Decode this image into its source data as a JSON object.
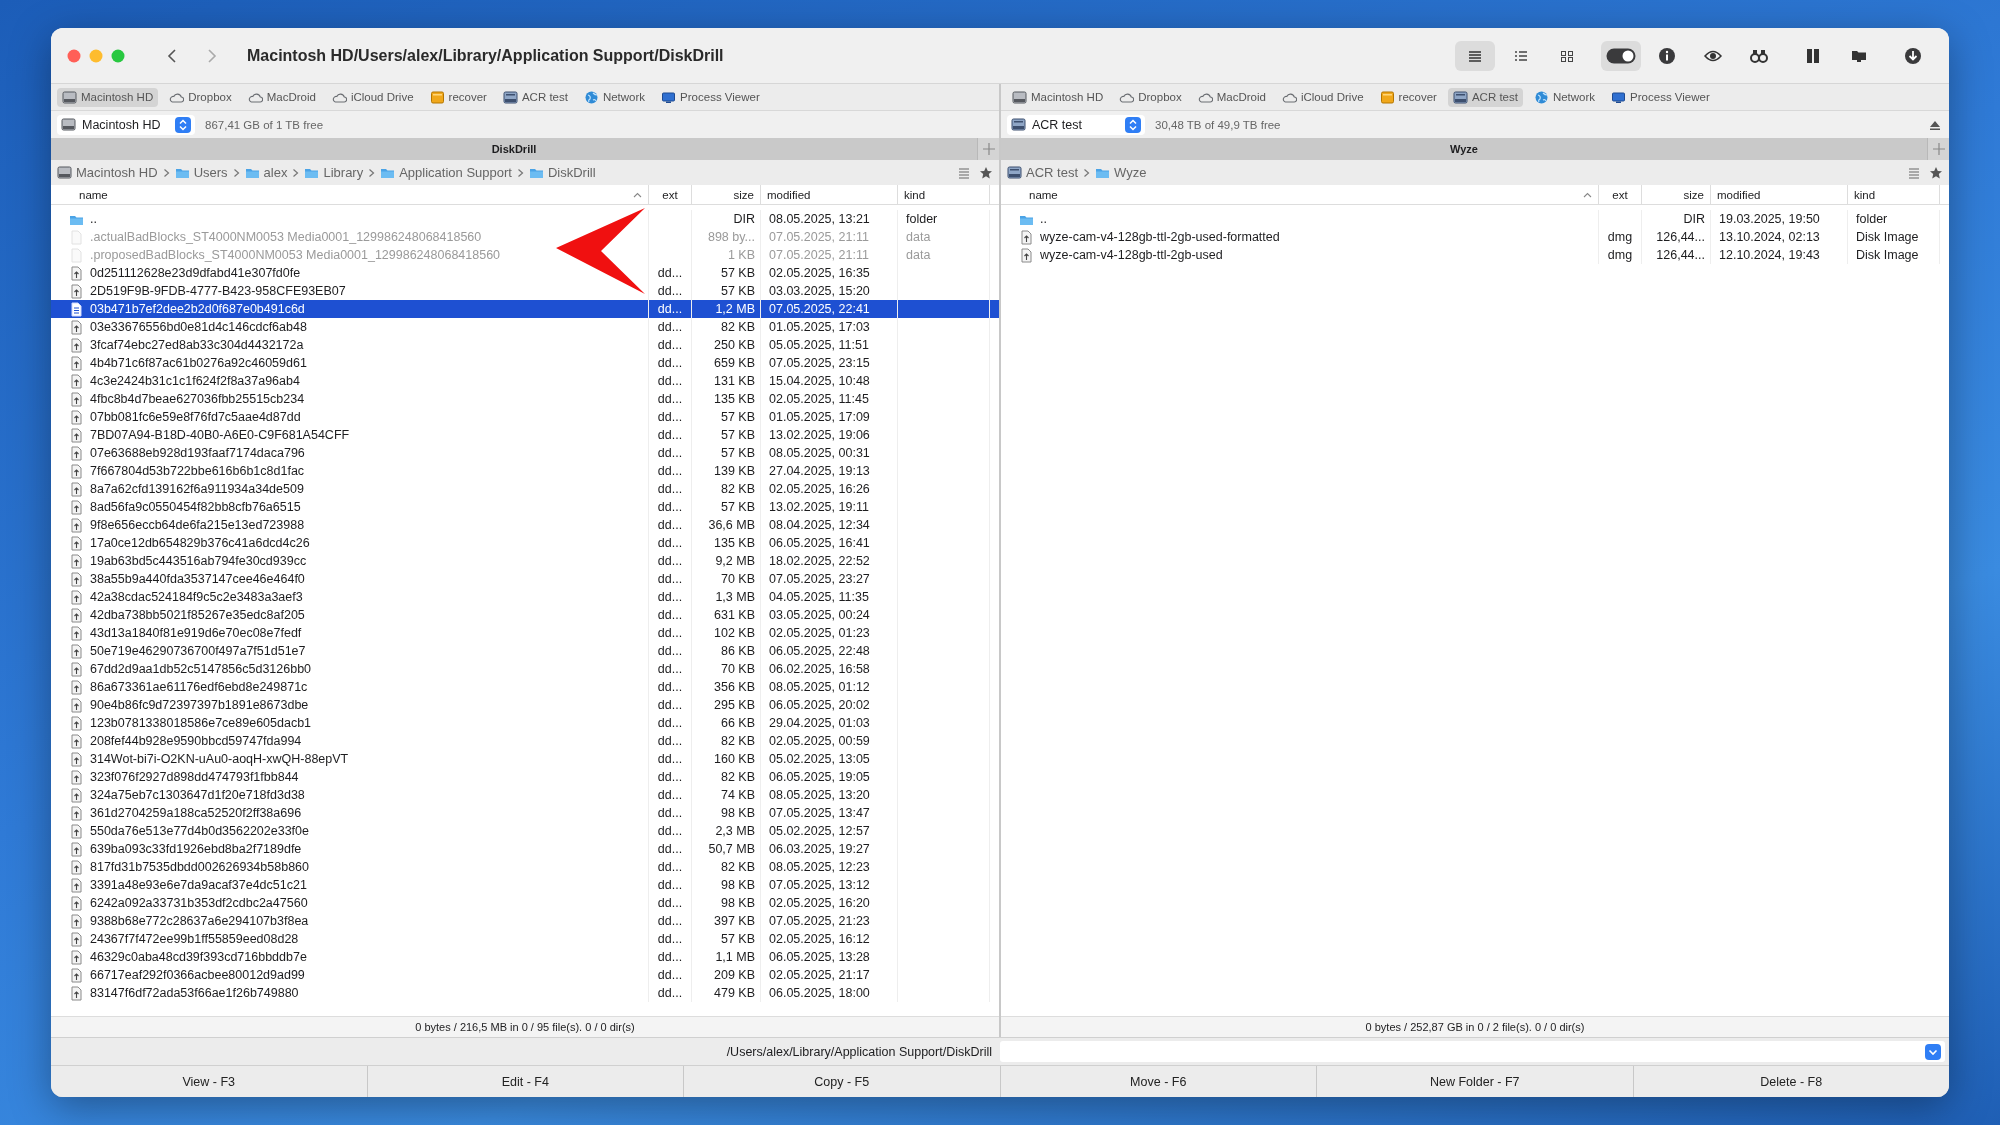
{
  "window": {
    "title": "Macintosh HD/Users/alex/Library/Application Support/DiskDrill"
  },
  "toolbar": {
    "view_buttons": [
      {
        "kind": "list",
        "selected": true
      },
      {
        "kind": "detail",
        "selected": false
      },
      {
        "kind": "grid",
        "selected": false
      }
    ],
    "hidden_files_toggle": {
      "on": true
    }
  },
  "panels": [
    {
      "favorites": [
        {
          "label": "Macintosh HD",
          "kind": "drive",
          "selected": true
        },
        {
          "label": "Dropbox",
          "kind": "cloud",
          "selected": false
        },
        {
          "label": "MacDroid",
          "kind": "cloud",
          "selected": false
        },
        {
          "label": "iCloud Drive",
          "kind": "cloud",
          "selected": false
        },
        {
          "label": "recover",
          "kind": "folder",
          "selected": false
        },
        {
          "label": "ACR test",
          "kind": "network-drive",
          "selected": false
        },
        {
          "label": "Network",
          "kind": "globe",
          "selected": false
        },
        {
          "label": "Process Viewer",
          "kind": "monitor",
          "selected": false
        }
      ],
      "drive": {
        "name": "Macintosh HD",
        "kind": "drive",
        "free": "867,41 GB of 1 TB free",
        "eject": false
      },
      "title": "DiskDrill",
      "breadcrumb": [
        {
          "label": "Macintosh HD",
          "kind": "drive"
        },
        {
          "label": "Users",
          "kind": "folder"
        },
        {
          "label": "alex",
          "kind": "folder"
        },
        {
          "label": "Library",
          "kind": "folder"
        },
        {
          "label": "Application Support",
          "kind": "folder"
        },
        {
          "label": "DiskDrill",
          "kind": "folder"
        }
      ],
      "columns": [
        "name",
        "ext",
        "size",
        "modified",
        "kind"
      ],
      "rows": [
        {
          "kind": "parent",
          "name": "..",
          "size": "DIR",
          "modified": "08.05.2025, 13:21",
          "type": "folder",
          "selected": false
        },
        {
          "kind": "hidden",
          "name": ".actualBadBlocks_ST4000NM0053 Media0001_129986248068418560",
          "size": "898 by...",
          "modified": "07.05.2025, 21:11",
          "type": "data",
          "selected": false
        },
        {
          "kind": "hidden",
          "name": ".proposedBadBlocks_ST4000NM0053 Media0001_129986248068418560",
          "size": "1 KB",
          "modified": "07.05.2025, 21:11",
          "type": "data",
          "selected": false
        },
        {
          "kind": "file",
          "name": "0d251112628e23d9dfabd41e307fd0fe",
          "ext": "dd...",
          "size": "57 KB",
          "modified": "02.05.2025, 16:35",
          "selected": false
        },
        {
          "kind": "file",
          "name": "2D519F9B-9FDB-4777-B423-958CFE93EB07",
          "ext": "dd...",
          "size": "57 KB",
          "modified": "03.03.2025, 15:20",
          "selected": false
        },
        {
          "kind": "file",
          "name": "03b471b7ef2dee2b2d0f687e0b491c6d",
          "ext": "dd...",
          "size": "1,2 MB",
          "modified": "07.05.2025, 22:41",
          "selected": true
        },
        {
          "kind": "file",
          "name": "03e33676556bd0e81d4c146cdcf6ab48",
          "ext": "dd...",
          "size": "82 KB",
          "modified": "01.05.2025, 17:03",
          "selected": false
        },
        {
          "kind": "file",
          "name": "3fcaf74ebc27ed8ab33c304d4432172a",
          "ext": "dd...",
          "size": "250 KB",
          "modified": "05.05.2025, 11:51",
          "selected": false
        },
        {
          "kind": "file",
          "name": "4b4b71c6f87ac61b0276a92c46059d61",
          "ext": "dd...",
          "size": "659 KB",
          "modified": "07.05.2025, 23:15",
          "selected": false
        },
        {
          "kind": "file",
          "name": "4c3e2424b31c1c1f624f2f8a37a96ab4",
          "ext": "dd...",
          "size": "131 KB",
          "modified": "15.04.2025, 10:48",
          "selected": false
        },
        {
          "kind": "file",
          "name": "4fbc8b4d7beae627036fbb25515cb234",
          "ext": "dd...",
          "size": "135 KB",
          "modified": "02.05.2025, 11:45",
          "selected": false
        },
        {
          "kind": "file",
          "name": "07bb081fc6e59e8f76fd7c5aae4d87dd",
          "ext": "dd...",
          "size": "57 KB",
          "modified": "01.05.2025, 17:09",
          "selected": false
        },
        {
          "kind": "file",
          "name": "7BD07A94-B18D-40B0-A6E0-C9F681A54CFF",
          "ext": "dd...",
          "size": "57 KB",
          "modified": "13.02.2025, 19:06",
          "selected": false
        },
        {
          "kind": "file",
          "name": "07e63688eb928d193faaf7174daca796",
          "ext": "dd...",
          "size": "57 KB",
          "modified": "08.05.2025, 00:31",
          "selected": false
        },
        {
          "kind": "file",
          "name": "7f667804d53b722bbe616b6b1c8d1fac",
          "ext": "dd...",
          "size": "139 KB",
          "modified": "27.04.2025, 19:13",
          "selected": false
        },
        {
          "kind": "file",
          "name": "8a7a62cfd139162f6a911934a34de509",
          "ext": "dd...",
          "size": "82 KB",
          "modified": "02.05.2025, 16:26",
          "selected": false
        },
        {
          "kind": "file",
          "name": "8ad56fa9c0550454f82bb8cfb76a6515",
          "ext": "dd...",
          "size": "57 KB",
          "modified": "13.02.2025, 19:11",
          "selected": false
        },
        {
          "kind": "file",
          "name": "9f8e656eccb64de6fa215e13ed723988",
          "ext": "dd...",
          "size": "36,6 MB",
          "modified": "08.04.2025, 12:34",
          "selected": false
        },
        {
          "kind": "file",
          "name": "17a0ce12db654829b376c41a6dcd4c26",
          "ext": "dd...",
          "size": "135 KB",
          "modified": "06.05.2025, 16:41",
          "selected": false
        },
        {
          "kind": "file",
          "name": "19ab63bd5c443516ab794fe30cd939cc",
          "ext": "dd...",
          "size": "9,2 MB",
          "modified": "18.02.2025, 22:52",
          "selected": false
        },
        {
          "kind": "file",
          "name": "38a55b9a440fda3537147cee46e464f0",
          "ext": "dd...",
          "size": "70 KB",
          "modified": "07.05.2025, 23:27",
          "selected": false
        },
        {
          "kind": "file",
          "name": "42a38cdac524184f9c5c2e3483a3aef3",
          "ext": "dd...",
          "size": "1,3 MB",
          "modified": "04.05.2025, 11:35",
          "selected": false
        },
        {
          "kind": "file",
          "name": "42dba738bb5021f85267e35edc8af205",
          "ext": "dd...",
          "size": "631 KB",
          "modified": "03.05.2025, 00:24",
          "selected": false
        },
        {
          "kind": "file",
          "name": "43d13a1840f81e919d6e70ec08e7fedf",
          "ext": "dd...",
          "size": "102 KB",
          "modified": "02.05.2025, 01:23",
          "selected": false
        },
        {
          "kind": "file",
          "name": "50e719e46290736700f497a7f51d51e7",
          "ext": "dd...",
          "size": "86 KB",
          "modified": "06.05.2025, 22:48",
          "selected": false
        },
        {
          "kind": "file",
          "name": "67dd2d9aa1db52c5147856c5d3126bb0",
          "ext": "dd...",
          "size": "70 KB",
          "modified": "06.02.2025, 16:58",
          "selected": false
        },
        {
          "kind": "file",
          "name": "86a673361ae61176edf6ebd8e249871c",
          "ext": "dd...",
          "size": "356 KB",
          "modified": "08.05.2025, 01:12",
          "selected": false
        },
        {
          "kind": "file",
          "name": "90e4b86fc9d72397397b1891e8673dbe",
          "ext": "dd...",
          "size": "295 KB",
          "modified": "06.05.2025, 20:02",
          "selected": false
        },
        {
          "kind": "file",
          "name": "123b0781338018586e7ce89e605dacb1",
          "ext": "dd...",
          "size": "66 KB",
          "modified": "29.04.2025, 01:03",
          "selected": false
        },
        {
          "kind": "file",
          "name": "208fef44b928e9590bbcd59747fda994",
          "ext": "dd...",
          "size": "82 KB",
          "modified": "02.05.2025, 00:59",
          "selected": false
        },
        {
          "kind": "file",
          "name": "314Wot-bi7i-O2KN-uAu0-aoqH-xwQH-88epVT",
          "ext": "dd...",
          "size": "160 KB",
          "modified": "05.02.2025, 13:05",
          "selected": false
        },
        {
          "kind": "file",
          "name": "323f076f2927d898dd474793f1fbb844",
          "ext": "dd...",
          "size": "82 KB",
          "modified": "06.05.2025, 19:05",
          "selected": false
        },
        {
          "kind": "file",
          "name": "324a75eb7c1303647d1f20e718fd3d38",
          "ext": "dd...",
          "size": "74 KB",
          "modified": "08.05.2025, 13:20",
          "selected": false
        },
        {
          "kind": "file",
          "name": "361d2704259a188ca52520f2ff38a696",
          "ext": "dd...",
          "size": "98 KB",
          "modified": "07.05.2025, 13:47",
          "selected": false
        },
        {
          "kind": "file",
          "name": "550da76e513e77d4b0d3562202e33f0e",
          "ext": "dd...",
          "size": "2,3 MB",
          "modified": "05.02.2025, 12:57",
          "selected": false
        },
        {
          "kind": "file",
          "name": "639ba093c33fd1926ebd8ba2f7189dfe",
          "ext": "dd...",
          "size": "50,7 MB",
          "modified": "06.03.2025, 19:27",
          "selected": false
        },
        {
          "kind": "file",
          "name": "817fd31b7535dbdd002626934b58b860",
          "ext": "dd...",
          "size": "82 KB",
          "modified": "08.05.2025, 12:23",
          "selected": false
        },
        {
          "kind": "file",
          "name": "3391a48e93e6e7da9acaf37e4dc51c21",
          "ext": "dd...",
          "size": "98 KB",
          "modified": "07.05.2025, 13:12",
          "selected": false
        },
        {
          "kind": "file",
          "name": "6242a092a33731b353df2cdbc2a47560",
          "ext": "dd...",
          "size": "98 KB",
          "modified": "02.05.2025, 16:20",
          "selected": false
        },
        {
          "kind": "file",
          "name": "9388b68e772c28637a6e294107b3f8ea",
          "ext": "dd...",
          "size": "397 KB",
          "modified": "07.05.2025, 21:23",
          "selected": false
        },
        {
          "kind": "file",
          "name": "24367f7f472ee99b1ff55859eed08d28",
          "ext": "dd...",
          "size": "57 KB",
          "modified": "02.05.2025, 16:12",
          "selected": false
        },
        {
          "kind": "file",
          "name": "46329c0aba48cd39f393cd716bbddb7e",
          "ext": "dd...",
          "size": "1,1 MB",
          "modified": "06.05.2025, 13:28",
          "selected": false
        },
        {
          "kind": "file",
          "name": "66717eaf292f0366acbee80012d9ad99",
          "ext": "dd...",
          "size": "209 KB",
          "modified": "02.05.2025, 21:17",
          "selected": false
        },
        {
          "kind": "file",
          "name": "83147f6df72ada53f66ae1f26b749880",
          "ext": "dd...",
          "size": "479 KB",
          "modified": "06.05.2025, 18:00",
          "selected": false
        }
      ],
      "status": "0 bytes / 216,5 MB in 0 / 95 file(s). 0 / 0 dir(s)"
    },
    {
      "favorites": [
        {
          "label": "Macintosh HD",
          "kind": "drive",
          "selected": false
        },
        {
          "label": "Dropbox",
          "kind": "cloud",
          "selected": false
        },
        {
          "label": "MacDroid",
          "kind": "cloud",
          "selected": false
        },
        {
          "label": "iCloud Drive",
          "kind": "cloud",
          "selected": false
        },
        {
          "label": "recover",
          "kind": "folder",
          "selected": false
        },
        {
          "label": "ACR test",
          "kind": "network-drive",
          "selected": true
        },
        {
          "label": "Network",
          "kind": "globe",
          "selected": false
        },
        {
          "label": "Process Viewer",
          "kind": "monitor",
          "selected": false
        }
      ],
      "drive": {
        "name": "ACR test",
        "kind": "network-drive",
        "free": "30,48 TB of 49,9 TB free",
        "eject": true
      },
      "title": "Wyze",
      "breadcrumb": [
        {
          "label": "ACR test",
          "kind": "network-drive"
        },
        {
          "label": "Wyze",
          "kind": "folder"
        }
      ],
      "columns": [
        "name",
        "ext",
        "size",
        "modified",
        "kind"
      ],
      "rows": [
        {
          "kind": "parent",
          "name": "..",
          "size": "DIR",
          "modified": "19.03.2025, 19:50",
          "type": "folder",
          "selected": false
        },
        {
          "kind": "file",
          "name": "wyze-cam-v4-128gb-ttl-2gb-used-formatted",
          "ext": "dmg",
          "size": "126,44...",
          "modified": "13.10.2024, 02:13",
          "type": "Disk Image",
          "selected": false
        },
        {
          "kind": "file",
          "name": "wyze-cam-v4-128gb-ttl-2gb-used",
          "ext": "dmg",
          "size": "126,44...",
          "modified": "12.10.2024, 19:43",
          "type": "Disk Image",
          "selected": false
        }
      ],
      "status": "0 bytes / 252,87 GB in 0 / 2 file(s). 0 / 0 dir(s)"
    }
  ],
  "command_line": {
    "path": "/Users/alex/Library/Application Support/DiskDrill"
  },
  "function_keys": [
    "View - F3",
    "Edit - F4",
    "Copy - F5",
    "Move - F6",
    "New Folder - F7",
    "Delete - F8"
  ]
}
